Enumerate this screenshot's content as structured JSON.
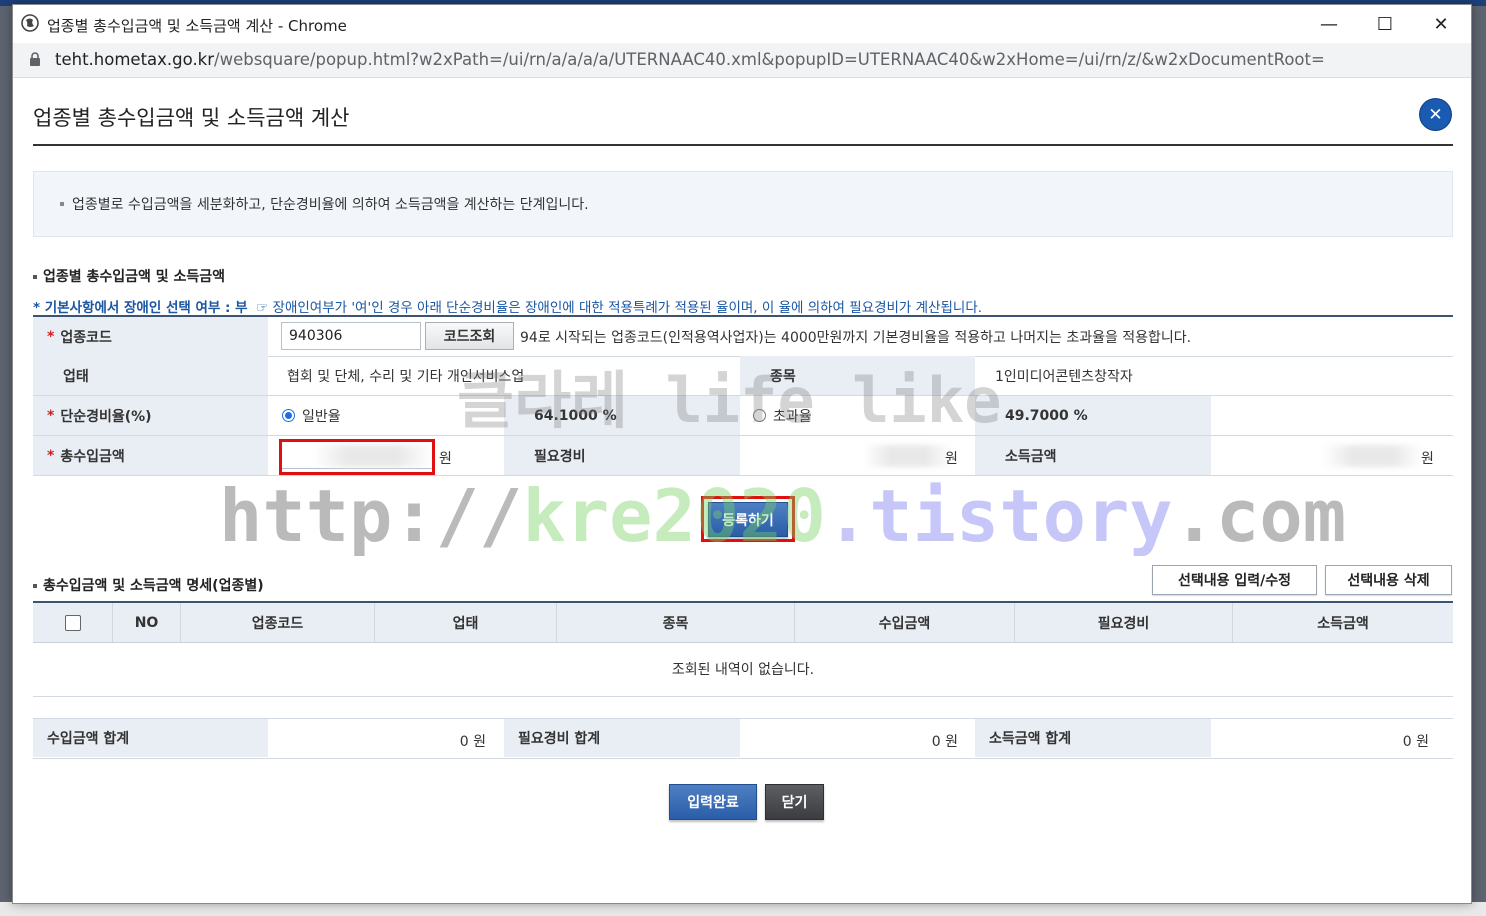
{
  "window": {
    "title": "업종별 총수입금액 및 소득금액 계산 - Chrome",
    "url_host": "teht.hometax.go.kr",
    "url_path": "/websquare/popup.html?w2xPath=/ui/rn/a/a/a/a/UTERNAAC40.xml&popupID=UTERNAAC40&w2xHome=/ui/rn/z/&w2xDocumentRoot=",
    "minimize_glyph": "—",
    "maximize_glyph": "☐",
    "close_glyph": "✕"
  },
  "page": {
    "title": "업종별 총수입금액 및 소득금액 계산",
    "close_glyph": "✕",
    "info_text": "업종별로 수입금액을 세분화하고, 단순경비율에 의하여 소득금액을 계산하는 단계입니다."
  },
  "form": {
    "section_title": "업종별 총수입금액 및 소득금액",
    "note_prefix": "* 기본사항에서 장애인 선택 여부 : 부",
    "note_text": "☞ 장애인여부가 '여'인 경우 아래 단순경비율은 장애인에 대한 적용특례가 적용된 율이며, 이 율에 의하여 필요경비가 계산됩니다.",
    "required_mark": "*",
    "industry_code_label": "업종코드",
    "industry_code_value": "940306",
    "code_lookup_button": "코드조회",
    "code_help": "94로 시작되는 업종코드(인적용역사업자)는 4000만원까지 기본경비율을 적용하고 나머지는 초과율을 적용합니다.",
    "business_type_label": "업태",
    "business_type_value": "협회 및 단체, 수리 및 기타 개인서비스업",
    "item_label": "종목",
    "item_value": "1인미디어콘텐츠창작자",
    "expense_rate_label": "단순경비율(%)",
    "general_rate_label": "일반율",
    "general_rate_value": "64.1000 %",
    "excess_rate_label": "초과율",
    "excess_rate_value": "49.7000 %",
    "total_income_label": "총수입금액",
    "won": "원",
    "expense_label": "필요경비",
    "income_label": "소득금액",
    "register_button": "등록하기"
  },
  "grid": {
    "section_title": "총수입금액 및 소득금액 명세(업종별)",
    "edit_button": "선택내용 입력/수정",
    "delete_button": "선택내용 삭제",
    "columns": [
      "NO",
      "업종코드",
      "업태",
      "종목",
      "수입금액",
      "필요경비",
      "소득금액"
    ],
    "empty_message": "조회된 내역이 없습니다."
  },
  "summary": {
    "income_total_label": "수입금액 합계",
    "income_total_value": "0 원",
    "expense_total_label": "필요경비 합계",
    "expense_total_value": "0 원",
    "earnings_total_label": "소득금액 합계",
    "earnings_total_value": "0 원"
  },
  "footer": {
    "complete_button": "입력완료",
    "close_button": "닫기"
  },
  "watermark": {
    "korean": "클라레 life like",
    "url_part1": "http://",
    "url_part2": "kre2020",
    "url_part3": ".tistory",
    "url_part4": ".com"
  },
  "colors": {
    "accent_blue": "#2a5da8",
    "required_red": "#d21c1c",
    "highlight_red": "#e01010",
    "note_blue": "#1a56a3"
  }
}
